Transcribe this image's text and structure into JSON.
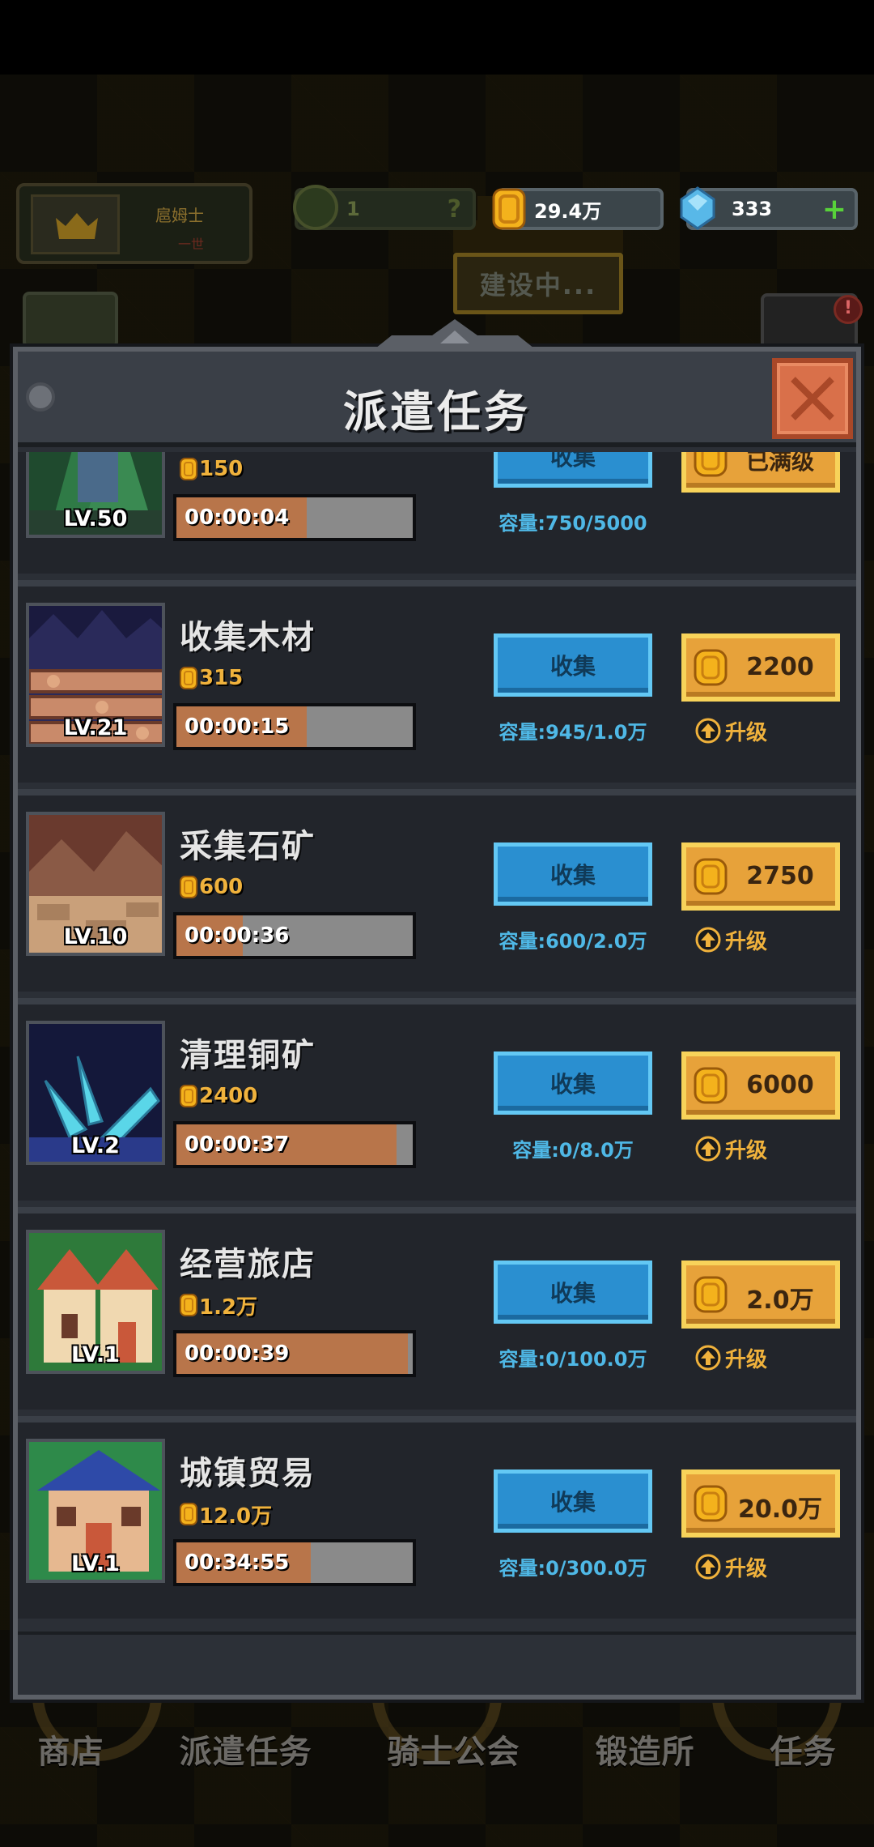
{
  "hud": {
    "player_name": "扈姆士",
    "player_sub": "一世",
    "quest_value": "1",
    "quest_mark": "?",
    "gold": "29.4万",
    "gems": "333",
    "gem_plus": "+",
    "building_sign": "建设中..."
  },
  "panel": {
    "title": "派遣任务",
    "tasks": [
      {
        "name": "",
        "level": "LV.50",
        "reward": "150",
        "time": "00:00:04",
        "progress": 0.55,
        "collect": "收集",
        "capacity": "容量:750/5000",
        "upgrade": "已满级",
        "upgrade_label": "",
        "scene": "forest"
      },
      {
        "name": "收集木材",
        "level": "LV.21",
        "reward": "315",
        "time": "00:00:15",
        "progress": 0.55,
        "collect": "收集",
        "capacity": "容量:945/1.0万",
        "upgrade": "2200",
        "upgrade_label": "升级",
        "scene": "wood"
      },
      {
        "name": "采集石矿",
        "level": "LV.10",
        "reward": "600",
        "time": "00:00:36",
        "progress": 0.28,
        "collect": "收集",
        "capacity": "容量:600/2.0万",
        "upgrade": "2750",
        "upgrade_label": "升级",
        "scene": "stone"
      },
      {
        "name": "清理铜矿",
        "level": "LV.2",
        "reward": "2400",
        "time": "00:00:37",
        "progress": 0.93,
        "collect": "收集",
        "capacity": "容量:0/8.0万",
        "upgrade": "6000",
        "upgrade_label": "升级",
        "scene": "copper"
      },
      {
        "name": "经营旅店",
        "level": "LV.1",
        "reward": "1.2万",
        "time": "00:00:39",
        "progress": 0.98,
        "collect": "收集",
        "capacity": "容量:0/100.0万",
        "upgrade": "2.0万",
        "upgrade_label": "升级",
        "scene": "inn"
      },
      {
        "name": "城镇贸易",
        "level": "LV.1",
        "reward": "12.0万",
        "time": "00:34:55",
        "progress": 0.57,
        "collect": "收集",
        "capacity": "容量:0/300.0万",
        "upgrade": "20.0万",
        "upgrade_label": "升级",
        "scene": "trade"
      }
    ]
  },
  "nav": {
    "items": [
      "商店",
      "派遣任务",
      "骑士公会",
      "锻造所",
      "任务"
    ]
  },
  "colors": {
    "collect_button": "#2a8fd0",
    "upgrade_button": "#e7a23a",
    "progress_fill": "#b8754a",
    "capacity_text": "#4fb8e6",
    "coin": "#f0b23c"
  },
  "icons": {
    "close": "close-icon",
    "coin": "coin-icon",
    "gem": "gem-icon",
    "upgrade": "upgrade-arrow-icon"
  }
}
